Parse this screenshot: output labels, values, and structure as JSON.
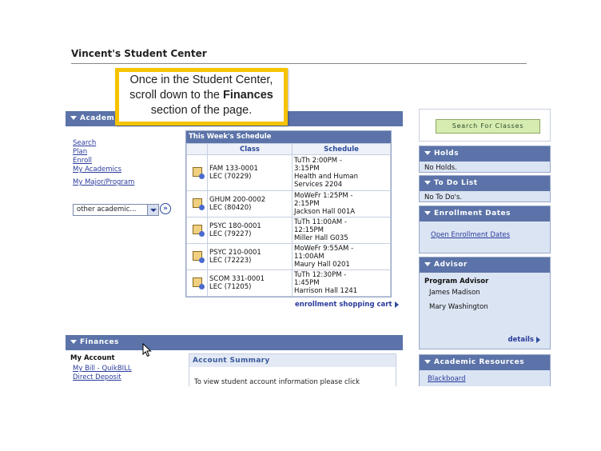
{
  "page": {
    "title": "Vincent's Student Center"
  },
  "callout": {
    "line1": "Once in the Student Center,",
    "line2_a": "scroll down to the ",
    "line2_b": "Finances",
    "line3": "section of the page."
  },
  "academics": {
    "header": "Academics",
    "links": [
      "Search",
      "Plan",
      "Enroll",
      "My Academics"
    ],
    "major_link": "My Major/Program",
    "dropdown_value": "other academic...",
    "go_label": "»"
  },
  "schedule": {
    "caption": "This Week's Schedule",
    "col_class": "Class",
    "col_schedule": "Schedule",
    "rows": [
      {
        "class1": "FAM 133-0001",
        "class2": "LEC (70229)",
        "s1": "TuTh 2:00PM -",
        "s2": "3:15PM",
        "s3": "Health and Human",
        "s4": "Services 2204"
      },
      {
        "class1": "GHUM 200-0002",
        "class2": "LEC (80420)",
        "s1": "MoWeFr 1:25PM -",
        "s2": "2:15PM",
        "s3": "Jackson Hall 001A"
      },
      {
        "class1": "PSYC 180-0001",
        "class2": "LEC (79227)",
        "s1": "TuTh 11:00AM -",
        "s2": "12:15PM",
        "s3": "Miller Hall G035"
      },
      {
        "class1": "PSYC 210-0001",
        "class2": "LEC (72223)",
        "s1": "MoWeFr 9:55AM -",
        "s2": "11:00AM",
        "s3": "Maury Hall 0201"
      },
      {
        "class1": "SCOM 331-0001",
        "class2": "LEC (71205)",
        "s1": "TuTh 12:30PM -",
        "s2": "1:45PM",
        "s3": "Harrison Hall 1241"
      }
    ],
    "cart_link": "enrollment shopping cart"
  },
  "sidebar": {
    "search_button": "Search For Classes",
    "holds_header": "Holds",
    "holds_text": "No Holds.",
    "todo_header": "To Do List",
    "todo_text": "No To Do's.",
    "enroll_header": "Enrollment Dates",
    "enroll_link": "Open Enrollment Dates",
    "advisor_header": "Advisor",
    "advisor_title": "Program Advisor",
    "advisor1": "James Madison",
    "advisor2": "Mary Washington",
    "details_link": "details",
    "resources_header": "Academic Resources",
    "resources_link": "Blackboard"
  },
  "finances": {
    "header": "Finances",
    "my_account": "My Account",
    "link1": "My Bill - QuikBILL",
    "link2": "Direct Deposit",
    "summary_header": "Account Summary",
    "summary_text": "To view student account information please click"
  }
}
